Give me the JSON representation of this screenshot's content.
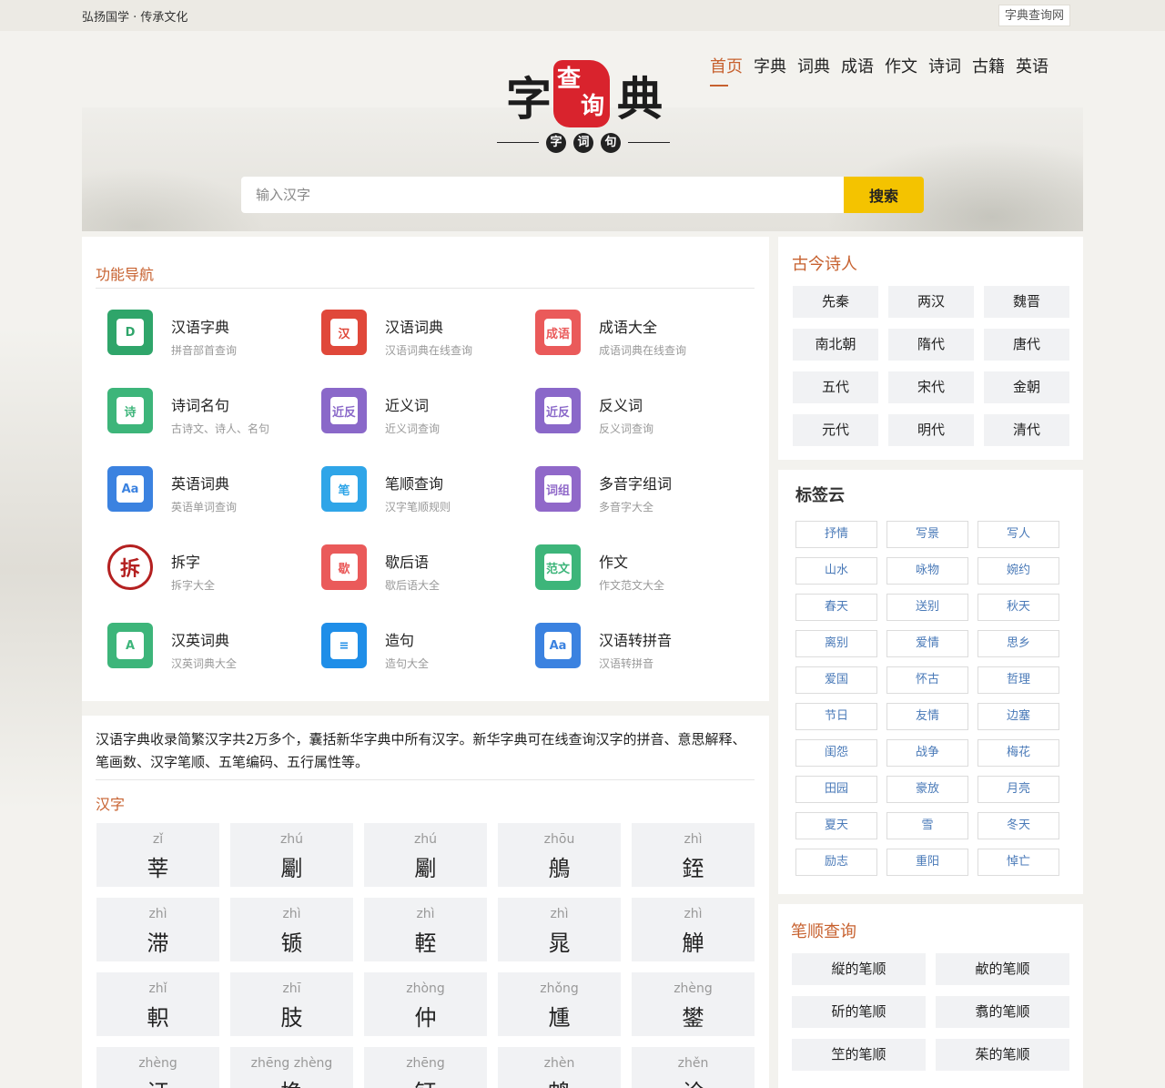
{
  "topbar": {
    "slogan": "弘扬国学 · 传承文化",
    "site_link": "字典查询网"
  },
  "logo": {
    "chars": [
      "字",
      "典"
    ],
    "seal_chars": [
      "查",
      "询"
    ],
    "dots": [
      "字",
      "词",
      "句"
    ]
  },
  "nav": [
    {
      "label": "首页",
      "active": true
    },
    {
      "label": "字典"
    },
    {
      "label": "词典"
    },
    {
      "label": "成语"
    },
    {
      "label": "作文"
    },
    {
      "label": "诗词"
    },
    {
      "label": "古籍"
    },
    {
      "label": "英语"
    }
  ],
  "search": {
    "placeholder": "输入汉字",
    "button": "搜索"
  },
  "functions": {
    "title": "功能导航",
    "items": [
      {
        "title": "汉语字典",
        "desc": "拼音部首查询",
        "icon": "dictionary-d-icon",
        "color": "#2fa56a",
        "glyph": "D"
      },
      {
        "title": "汉语词典",
        "desc": "汉语词典在线查询",
        "icon": "han-book-icon",
        "color": "#e0483a",
        "glyph": "汉"
      },
      {
        "title": "成语大全",
        "desc": "成语词典在线查询",
        "icon": "idiom-book-icon",
        "color": "#ea5a5a",
        "glyph": "成语"
      },
      {
        "title": "诗词名句",
        "desc": "古诗文、诗人、名句",
        "icon": "poem-book-icon",
        "color": "#3db57a",
        "glyph": "诗"
      },
      {
        "title": "近义词",
        "desc": "近义词查询",
        "icon": "synonym-icon",
        "color": "#8a68c9",
        "glyph": "近反"
      },
      {
        "title": "反义词",
        "desc": "反义词查询",
        "icon": "antonym-icon",
        "color": "#8a68c9",
        "glyph": "近反"
      },
      {
        "title": "英语词典",
        "desc": "英语单词查询",
        "icon": "english-aa-icon",
        "color": "#3b82e0",
        "glyph": "Aa"
      },
      {
        "title": "笔顺查询",
        "desc": "汉字笔顺规则",
        "icon": "stroke-pen-icon",
        "color": "#2fa5e8",
        "glyph": "笔"
      },
      {
        "title": "多音字组词",
        "desc": "多音字大全",
        "icon": "polyphone-icon",
        "color": "#9068c9",
        "glyph": "词组"
      },
      {
        "title": "拆字",
        "desc": "拆字大全",
        "icon": "split-char-icon",
        "color": "#ffffff",
        "glyph": "拆"
      },
      {
        "title": "歇后语",
        "desc": "歇后语大全",
        "icon": "xiehouyu-icon",
        "color": "#ea5a5a",
        "glyph": "歇"
      },
      {
        "title": "作文",
        "desc": "作文范文大全",
        "icon": "essay-doc-icon",
        "color": "#3db57a",
        "glyph": "范文"
      },
      {
        "title": "汉英词典",
        "desc": "汉英词典大全",
        "icon": "han-english-a-icon",
        "color": "#3db57a",
        "glyph": "A"
      },
      {
        "title": "造句",
        "desc": "造句大全",
        "icon": "chat-bubble-icon",
        "color": "#1f8ee8",
        "glyph": "≡"
      },
      {
        "title": "汉语转拼音",
        "desc": "汉语转拼音",
        "icon": "pinyin-aa-icon",
        "color": "#3b82e0",
        "glyph": "Aa"
      }
    ]
  },
  "chars": {
    "intro": "汉语字典收录简繁汉字共2万多个，囊括新华字典中所有汉字。新华字典可在线查询汉字的拼音、意思解释、笔画数、汉字笔顺、五笔编码、五行属性等。",
    "title": "汉字",
    "items": [
      {
        "py": "zǐ",
        "hz": "莘"
      },
      {
        "py": "zhú",
        "hz": "劚"
      },
      {
        "py": "zhú",
        "hz": "劚"
      },
      {
        "py": "zhōu",
        "hz": "鵃"
      },
      {
        "py": "zhì",
        "hz": "銍"
      },
      {
        "py": "zhì",
        "hz": "滞"
      },
      {
        "py": "zhì",
        "hz": "锧"
      },
      {
        "py": "zhì",
        "hz": "輊"
      },
      {
        "py": "zhì",
        "hz": "晁"
      },
      {
        "py": "zhì",
        "hz": "觯"
      },
      {
        "py": "zhǐ",
        "hz": "軹"
      },
      {
        "py": "zhī",
        "hz": "肢"
      },
      {
        "py": "zhòng",
        "hz": "仲"
      },
      {
        "py": "zhǒng",
        "hz": "尰"
      },
      {
        "py": "zhèng",
        "hz": "鐢"
      },
      {
        "py": "zhèng",
        "hz": "证"
      },
      {
        "py": "zhēng zhèng",
        "hz": "挣"
      },
      {
        "py": "zhēng",
        "hz": "钲"
      },
      {
        "py": "zhèn",
        "hz": "鸩"
      },
      {
        "py": "zhěn",
        "hz": "诊"
      }
    ]
  },
  "poets": {
    "title": "古今诗人",
    "eras": [
      "先秦",
      "两汉",
      "魏晋",
      "南北朝",
      "隋代",
      "唐代",
      "五代",
      "宋代",
      "金朝",
      "元代",
      "明代",
      "清代"
    ]
  },
  "tags": {
    "title": "标签云",
    "items": [
      "抒情",
      "写景",
      "写人",
      "山水",
      "咏物",
      "婉约",
      "春天",
      "送别",
      "秋天",
      "离别",
      "爱情",
      "思乡",
      "爱国",
      "怀古",
      "哲理",
      "节日",
      "友情",
      "边塞",
      "闺怨",
      "战争",
      "梅花",
      "田园",
      "豪放",
      "月亮",
      "夏天",
      "雪",
      "冬天",
      "励志",
      "重阳",
      "悼亡"
    ]
  },
  "strokes": {
    "title": "笔顺查询",
    "items": [
      "縦的笔顺",
      "欳的笔顺",
      "斫的笔顺",
      "翥的笔顺",
      "笁的笔顺",
      "茱的笔顺"
    ]
  }
}
